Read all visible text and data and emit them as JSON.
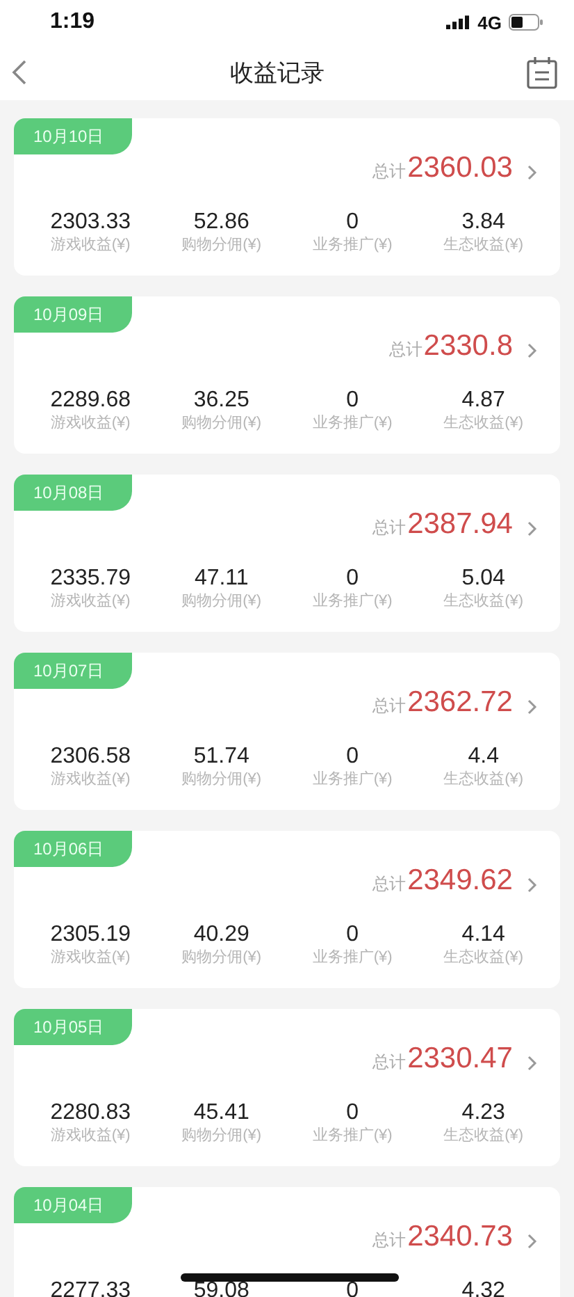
{
  "status_bar": {
    "time": "1:19",
    "network": "4G"
  },
  "nav": {
    "title": "收益记录"
  },
  "records": [
    {
      "date": "10月10日",
      "total_label": "总计",
      "total": "2360.03",
      "stats": [
        {
          "value": "2303.33",
          "label": "游戏收益(¥)"
        },
        {
          "value": "52.86",
          "label": "购物分佣(¥)"
        },
        {
          "value": "0",
          "label": "业务推广(¥)"
        },
        {
          "value": "3.84",
          "label": "生态收益(¥)"
        }
      ]
    },
    {
      "date": "10月09日",
      "total_label": "总计",
      "total": "2330.8",
      "stats": [
        {
          "value": "2289.68",
          "label": "游戏收益(¥)"
        },
        {
          "value": "36.25",
          "label": "购物分佣(¥)"
        },
        {
          "value": "0",
          "label": "业务推广(¥)"
        },
        {
          "value": "4.87",
          "label": "生态收益(¥)"
        }
      ]
    },
    {
      "date": "10月08日",
      "total_label": "总计",
      "total": "2387.94",
      "stats": [
        {
          "value": "2335.79",
          "label": "游戏收益(¥)"
        },
        {
          "value": "47.11",
          "label": "购物分佣(¥)"
        },
        {
          "value": "0",
          "label": "业务推广(¥)"
        },
        {
          "value": "5.04",
          "label": "生态收益(¥)"
        }
      ]
    },
    {
      "date": "10月07日",
      "total_label": "总计",
      "total": "2362.72",
      "stats": [
        {
          "value": "2306.58",
          "label": "游戏收益(¥)"
        },
        {
          "value": "51.74",
          "label": "购物分佣(¥)"
        },
        {
          "value": "0",
          "label": "业务推广(¥)"
        },
        {
          "value": "4.4",
          "label": "生态收益(¥)"
        }
      ]
    },
    {
      "date": "10月06日",
      "total_label": "总计",
      "total": "2349.62",
      "stats": [
        {
          "value": "2305.19",
          "label": "游戏收益(¥)"
        },
        {
          "value": "40.29",
          "label": "购物分佣(¥)"
        },
        {
          "value": "0",
          "label": "业务推广(¥)"
        },
        {
          "value": "4.14",
          "label": "生态收益(¥)"
        }
      ]
    },
    {
      "date": "10月05日",
      "total_label": "总计",
      "total": "2330.47",
      "stats": [
        {
          "value": "2280.83",
          "label": "游戏收益(¥)"
        },
        {
          "value": "45.41",
          "label": "购物分佣(¥)"
        },
        {
          "value": "0",
          "label": "业务推广(¥)"
        },
        {
          "value": "4.23",
          "label": "生态收益(¥)"
        }
      ]
    },
    {
      "date": "10月04日",
      "total_label": "总计",
      "total": "2340.73",
      "stats": [
        {
          "value": "2277.33"
        },
        {
          "value": "59.08"
        },
        {
          "value": "0"
        },
        {
          "value": "4.32"
        }
      ]
    }
  ]
}
